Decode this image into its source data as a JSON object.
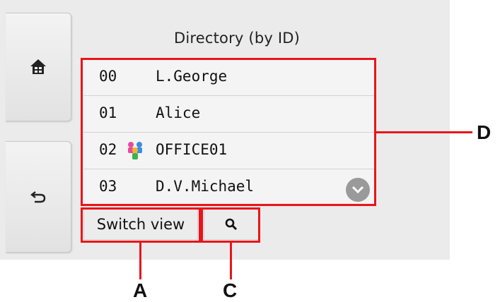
{
  "screen": {
    "title": "Directory (by ID)"
  },
  "sidebar": {
    "home_icon": "home-icon",
    "back_icon": "back-arrow-icon"
  },
  "directory": {
    "entries": [
      {
        "id": "00",
        "name": "L.George",
        "group": false
      },
      {
        "id": "01",
        "name": "Alice",
        "group": false
      },
      {
        "id": "02",
        "name": "OFFICE01",
        "group": true
      },
      {
        "id": "03",
        "name": "D.V.Michael",
        "group": false
      }
    ],
    "scroll_icon": "chevron-down-icon",
    "group_icon": "group-icon"
  },
  "buttons": {
    "switch_view": "Switch view",
    "search_icon": "search-icon"
  },
  "callouts": {
    "a": "A",
    "c": "C",
    "d": "D"
  },
  "colors": {
    "callout": "#e8151b",
    "screen_bg": "#ebebeb"
  }
}
